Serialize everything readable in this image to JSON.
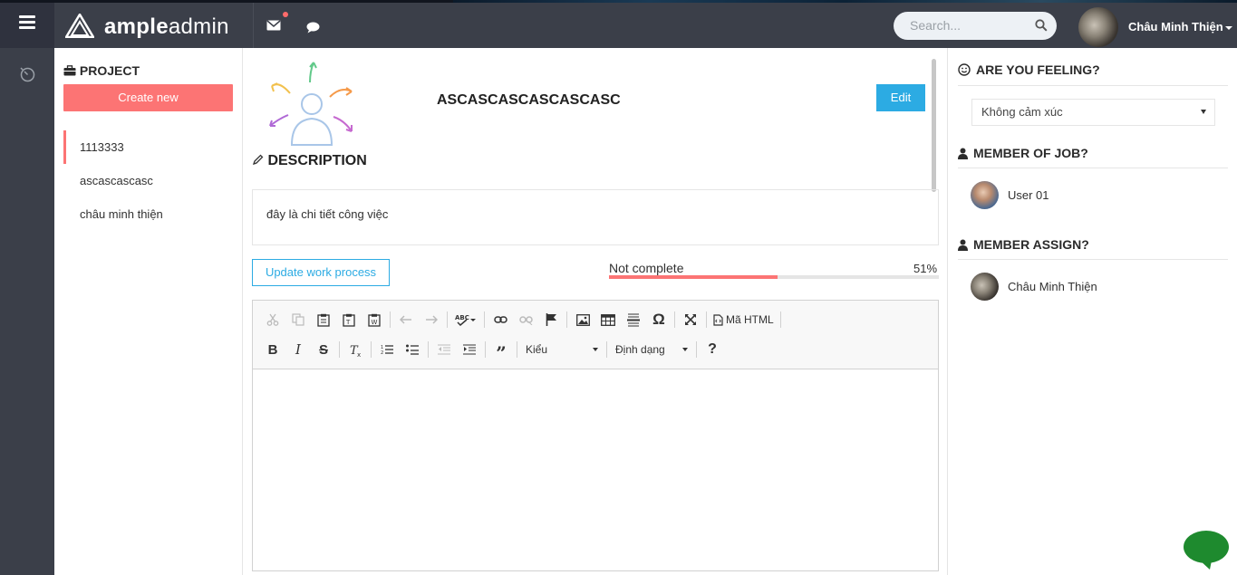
{
  "topbar": {
    "brand_bold": "ample",
    "brand_light": "admin",
    "search_placeholder": "Search...",
    "user_name": "Châu Minh Thiện"
  },
  "project": {
    "title": "PROJECT",
    "create_label": "Create new",
    "items": [
      {
        "label": "1113333",
        "active": true
      },
      {
        "label": "ascascascasc",
        "active": false
      },
      {
        "label": "châu minh thiện",
        "active": false
      }
    ]
  },
  "job": {
    "title": "ASCASCASCASCASCASC",
    "edit_label": "Edit",
    "description_title": "DESCRIPTION",
    "description_text": "đây là chi tiết công việc",
    "update_label": "Update work process",
    "progress_label": "Not complete",
    "progress_percent": 51,
    "progress_text": "51%"
  },
  "editor": {
    "style_combo": "Kiểu",
    "format_combo": "Định dạng",
    "html_label": "Mã HTML",
    "help_label": "?"
  },
  "right": {
    "feeling_title": "ARE YOU FEELING?",
    "feeling_value": "Không cảm xúc",
    "member_job_title": "MEMBER OF JOB?",
    "member_job": [
      {
        "name": "User 01"
      }
    ],
    "member_assign_title": "MEMBER ASSIGN?",
    "member_assign": [
      {
        "name": "Châu Minh Thiện"
      }
    ]
  },
  "colors": {
    "accent_red": "#fc7474",
    "accent_blue": "#2cabe3",
    "dark_bar": "#3b3f49"
  }
}
